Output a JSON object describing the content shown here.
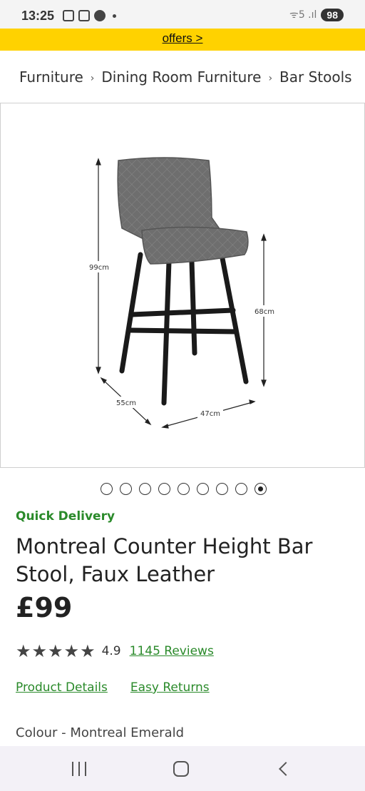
{
  "status_bar": {
    "time": "13:25",
    "battery": "98",
    "signal": "ᯤ5 .ıl"
  },
  "promo": {
    "link_text": "offers >"
  },
  "breadcrumb": {
    "items": [
      "Furniture",
      "Dining Room Furniture",
      "Bar Stools"
    ],
    "separator": "›"
  },
  "product_image": {
    "dimensions": {
      "height_total": "99cm",
      "seat_height": "68cm",
      "depth": "55cm",
      "width": "47cm"
    }
  },
  "carousel": {
    "total": 9,
    "active_index": 8
  },
  "product": {
    "delivery_badge": "Quick Delivery",
    "title": "Montreal Counter Height Bar Stool, Faux Leather",
    "price": "£99",
    "stars": "★★★★★",
    "rating": "4.9",
    "reviews_link": "1145 Reviews",
    "details_link": "Product Details",
    "returns_link": "Easy Returns",
    "colour": "Colour - Montreal Emerald"
  },
  "colors": {
    "promo_bg": "#ffd200",
    "accent_green": "#2a8a2a",
    "stool_seat": "#6b6b6b",
    "stool_legs": "#1a1a1a"
  },
  "nav_bar": {
    "recents": "recents-icon",
    "home": "home-icon",
    "back": "back-icon"
  }
}
